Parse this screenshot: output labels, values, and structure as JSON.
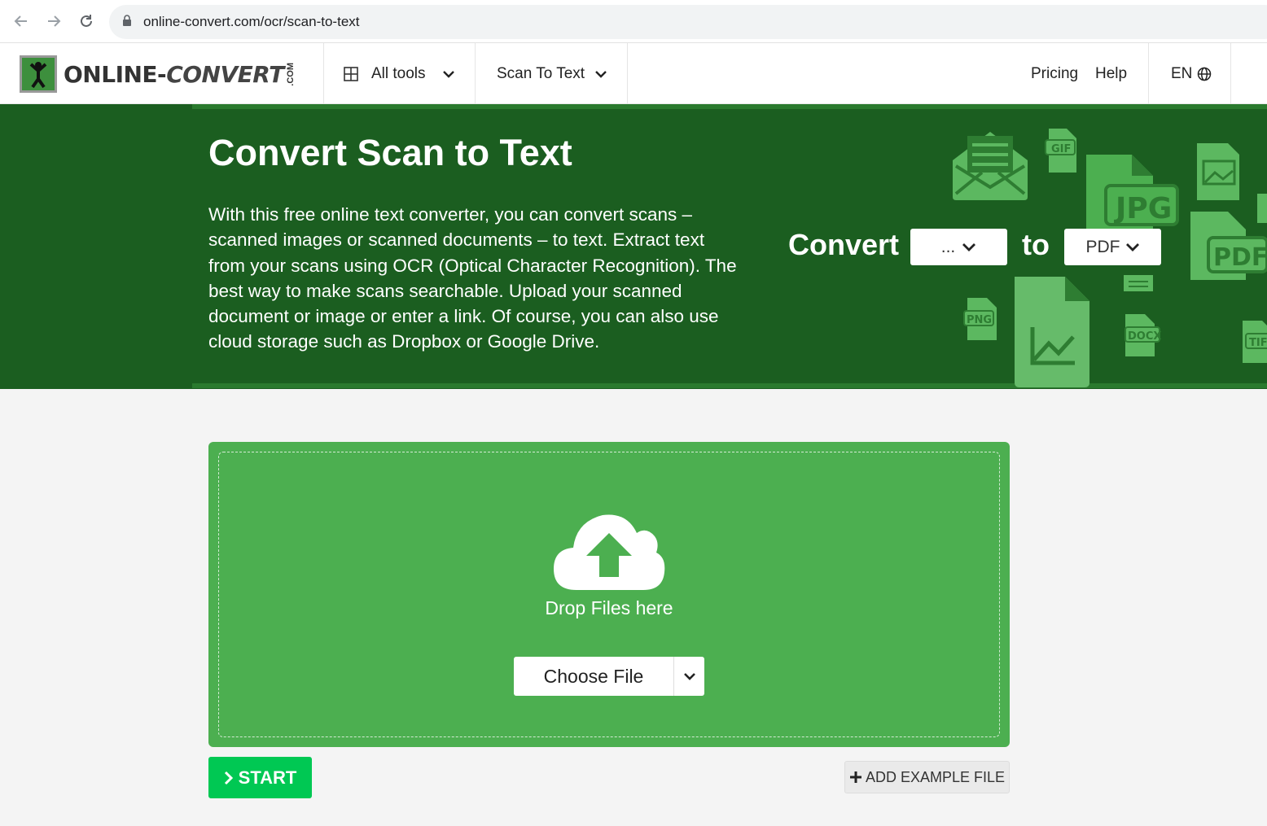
{
  "browser": {
    "url": "online-convert.com/ocr/scan-to-text"
  },
  "header": {
    "logo_text_a": "ONLINE-",
    "logo_text_b": "CONVERT",
    "logo_com": ".COM",
    "all_tools": "All tools",
    "scan_to_text": "Scan To Text",
    "pricing": "Pricing",
    "help": "Help",
    "language": "EN"
  },
  "hero": {
    "title": "Convert Scan to Text",
    "description": "With this free online text converter, you can convert scans – scanned images or scanned documents – to text. Extract text from your scans using OCR (Optical Character Recognition). The best way to make scans searchable. Upload your scanned document or image or enter a link. Of course, you can also use cloud storage such as Dropbox or Google Drive.",
    "convert_label": "Convert",
    "from_value": "...",
    "to_label": "to",
    "to_value": "PDF",
    "file_badges": [
      "GIF",
      "JPG",
      "PDF",
      "PNG",
      "DOCX",
      "TIF"
    ]
  },
  "upload": {
    "drop_text": "Drop Files here",
    "choose_file": "Choose File"
  },
  "actions": {
    "start": "START",
    "add_example": "ADD EXAMPLE FILE"
  },
  "colors": {
    "hero_bg": "#1b5e20",
    "upload_bg": "#4caf50",
    "start_bg": "#00c853",
    "deco_green": "#5cb860"
  }
}
